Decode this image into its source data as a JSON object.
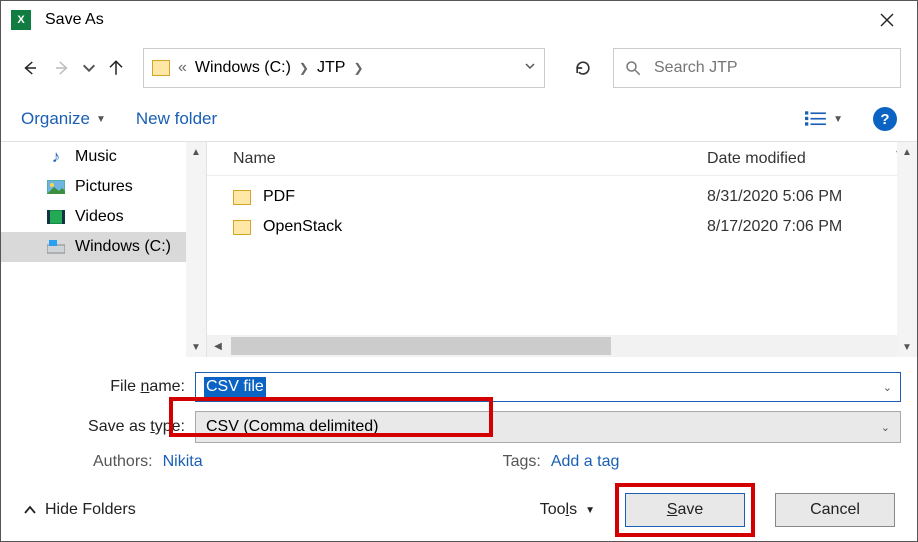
{
  "title": "Save As",
  "breadcrumbs": {
    "prefix": "«",
    "drive": "Windows (C:)",
    "folder": "JTP"
  },
  "search": {
    "placeholder": "Search JTP"
  },
  "toolbar": {
    "organize": "Organize",
    "new_folder": "New folder"
  },
  "sidebar": {
    "items": [
      {
        "label": "Music"
      },
      {
        "label": "Pictures"
      },
      {
        "label": "Videos"
      },
      {
        "label": "Windows (C:)"
      }
    ]
  },
  "columns": {
    "name": "Name",
    "date": "Date modified"
  },
  "files": [
    {
      "name": "PDF",
      "date": "8/31/2020 5:06 PM"
    },
    {
      "name": "OpenStack",
      "date": "8/17/2020 7:06 PM"
    }
  ],
  "form": {
    "filename_label": "File name:",
    "filename_value": "CSV file",
    "savetype_label": "Save as type:",
    "savetype_value": "CSV (Comma delimited)",
    "authors_label": "Authors:",
    "authors_value": "Nikita",
    "tags_label": "Tags:",
    "tags_value": "Add a tag"
  },
  "footer": {
    "hide_folders": "Hide Folders",
    "tools": "Tools",
    "save": "Save",
    "cancel": "Cancel"
  }
}
